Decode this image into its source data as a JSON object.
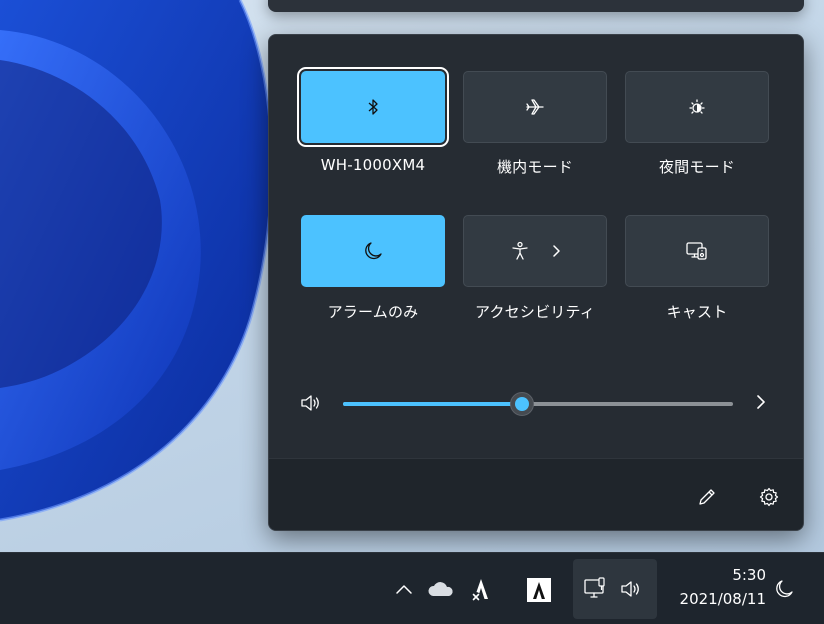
{
  "quick_settings": {
    "tiles": [
      {
        "label": "WH-1000XM4",
        "icon": "bluetooth-icon",
        "state": "on"
      },
      {
        "label": "機内モード",
        "icon": "airplane-icon",
        "state": "off"
      },
      {
        "label": "夜間モード",
        "icon": "brightness-icon",
        "state": "off"
      },
      {
        "label": "アラームのみ",
        "icon": "moon-icon",
        "state": "on"
      },
      {
        "label": "アクセシビリティ",
        "icon": "accessibility-icon",
        "state": "off"
      },
      {
        "label": "キャスト",
        "icon": "cast-icon",
        "state": "off"
      }
    ],
    "volume": {
      "icon": "speaker-icon",
      "level_percent": 46
    }
  },
  "footer": {
    "edit_icon": "pencil-icon",
    "settings_icon": "gear-icon"
  },
  "taskbar": {
    "icons": [
      "chevron-up-icon",
      "onedrive-cloud-icon",
      "adobe-icon",
      "adobe-icon",
      "network-icon",
      "speaker-icon",
      "moon-icon"
    ],
    "time": "5:30",
    "date": "2021/08/11"
  },
  "colors": {
    "accent": "#4cc2ff",
    "panel": "#262c33",
    "tile": "#323a42",
    "taskbar": "#1e252d"
  }
}
